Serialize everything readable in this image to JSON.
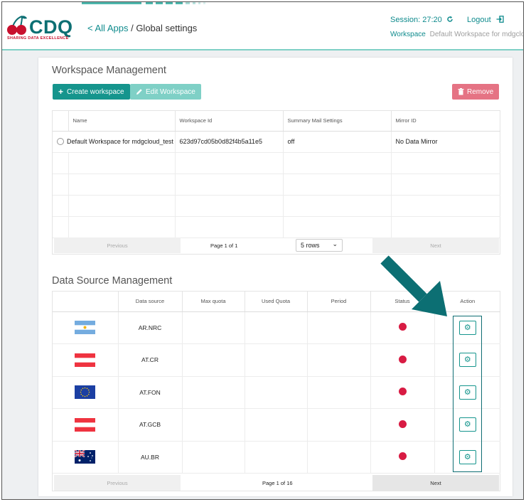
{
  "header": {
    "logo_text": "CDQ",
    "logo_tagline": "SHARING DATA EXCELLENCE",
    "breadcrumb_back": "< All Apps",
    "breadcrumb_sep": " / ",
    "page_title": "Global settings",
    "session_label": "Session: 27:20",
    "logout_label": "Logout",
    "workspace_label": "Workspace",
    "workspace_value": "Default Workspace for mdgcloud_test"
  },
  "workspace_management": {
    "title": "Workspace Management",
    "create_button": "Create workspace",
    "edit_button": "Edit Workspace",
    "remove_button": "Remove",
    "columns": [
      "Name",
      "Workspace Id",
      "Summary Mail Settings",
      "Mirror ID"
    ],
    "rows": [
      {
        "name": "Default Workspace for mdgcloud_test",
        "workspace_id": "623d97cd05b0d82f4b5a11e5",
        "summary_mail": "off",
        "mirror_id": "No Data Mirror"
      }
    ],
    "pager": {
      "previous": "Previous",
      "page_info": "Page 1 of 1",
      "rows_option": "5 rows",
      "next": "Next"
    }
  },
  "data_source_management": {
    "title": "Data Source Management",
    "columns": [
      "",
      "Data source",
      "Max quota",
      "Used Quota",
      "Period",
      "Status",
      "Action"
    ],
    "rows": [
      {
        "flag": "argentina-flag",
        "data_source": "AR.NRC",
        "status_color": "#d81b43"
      },
      {
        "flag": "austria-flag",
        "data_source": "AT.CR",
        "status_color": "#d81b43"
      },
      {
        "flag": "eu-flag",
        "data_source": "AT.FON",
        "status_color": "#d81b43"
      },
      {
        "flag": "austria-flag",
        "data_source": "AT.GCB",
        "status_color": "#d81b43"
      },
      {
        "flag": "australia-flag",
        "data_source": "AU.BR",
        "status_color": "#d81b43"
      }
    ],
    "pager": {
      "previous": "Previous",
      "page_info": "Page 1 of 16",
      "next": "Next"
    }
  },
  "colors": {
    "accent": "#15958d",
    "brand_dark": "#0c6f73",
    "danger": "#e57384",
    "status_red": "#d81b43"
  }
}
